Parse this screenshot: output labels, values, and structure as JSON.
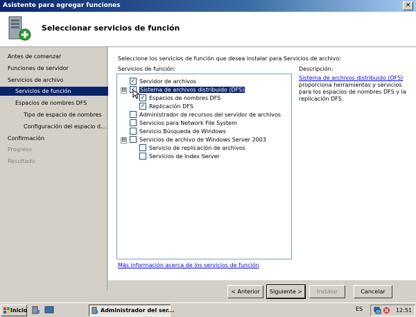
{
  "window": {
    "title": "Asistente para agregar funciones",
    "header_title": "Seleccionar servicios de función",
    "close_label": "✕"
  },
  "nav": {
    "items": [
      {
        "label": "Antes de comenzar",
        "state": "normal"
      },
      {
        "label": "Funciones de servidor",
        "state": "normal"
      },
      {
        "label": "Servicios de archivo",
        "state": "normal"
      },
      {
        "label": "Servicios de función",
        "state": "selected"
      },
      {
        "label": "Espacios de nombres DFS",
        "state": "normal"
      },
      {
        "label": "Tipo de espacio de nombres",
        "state": "normal"
      },
      {
        "label": "Configuración del espacio d...",
        "state": "normal"
      },
      {
        "label": "Confirmación",
        "state": "normal"
      },
      {
        "label": "Progreso",
        "state": "disabled"
      },
      {
        "label": "Resultado",
        "state": "disabled"
      }
    ]
  },
  "content": {
    "instructions": "Seleccione los servicios de función que desea instalar para Servicios de archivo:",
    "roles_label": "Servicios de función:",
    "description_label": "Descripción:",
    "description_link": "Sistema de archivos distribuido (DFS)",
    "description_text": "proporciona herramientas y servicios para los espacios de nombres DFS y la replicación DFS.",
    "more_info_link": "Más información acerca de los servicios de función",
    "tree": [
      {
        "label": "Servidor de archivos",
        "checked": true
      },
      {
        "label": "Sistema de archivos distribuido (DFS)",
        "checked": true,
        "expander": "⊟",
        "highlighted": true
      },
      {
        "label": "Espacios de nombres DFS",
        "checked": true
      },
      {
        "label": "Replicación DFS",
        "checked": true
      },
      {
        "label": "Administrador de recursos del servidor de archivos",
        "checked": false
      },
      {
        "label": "Servicios para Network File System",
        "checked": false
      },
      {
        "label": "Servicio Búsqueda de Windows",
        "checked": false
      },
      {
        "label": "Servicios de archivo de Windows Server 2003",
        "checked": false,
        "expander": "⊟"
      },
      {
        "label": "Servicio de replicación de archivos",
        "checked": false
      },
      {
        "label": "Servicios de Index Server",
        "checked": false
      }
    ]
  },
  "buttons": {
    "back": "< Anterior",
    "next": "Siguiente >",
    "install": "Instalar",
    "cancel": "Cancelar"
  },
  "taskbar": {
    "start": "Inicio",
    "task": "Administrador del ser...",
    "language": "ES",
    "clock": "12:51"
  },
  "colors": {
    "selection": "#0a246a",
    "link": "#0000ee",
    "check": "#000000"
  }
}
